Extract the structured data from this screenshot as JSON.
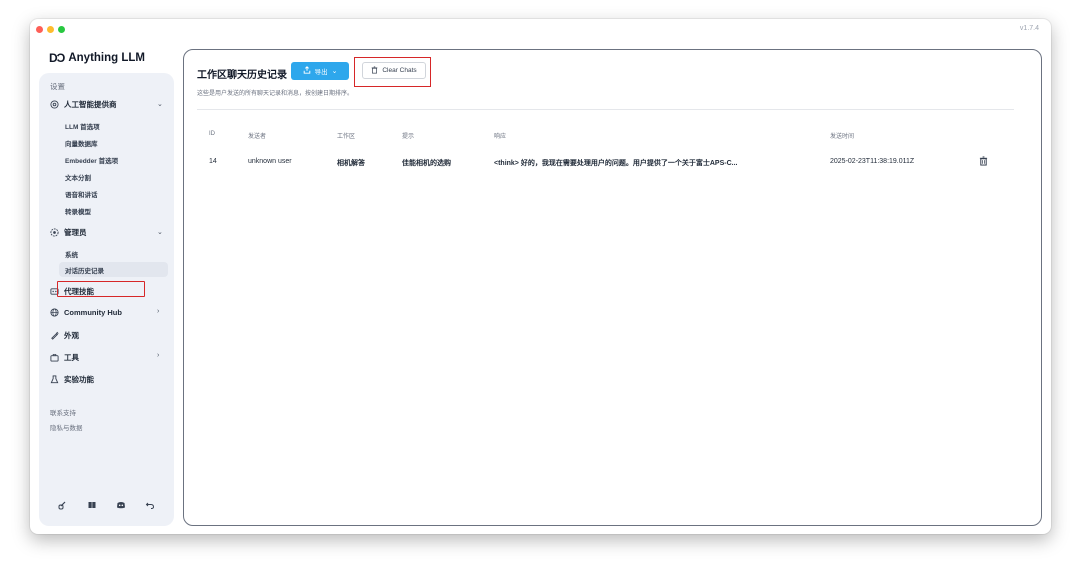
{
  "window": {
    "version": "v1.7.4"
  },
  "sidebar": {
    "brand_logo": "DƆ",
    "brand": "Anything LLM",
    "settings_header": "设置",
    "groups": [
      {
        "label": "人工智能提供商",
        "icon": "gear-circle-icon",
        "expanded": true,
        "items": [
          "LLM 首选项",
          "向量数据库",
          "Embedder 首选项",
          "文本分割",
          "语音和讲话",
          "转录模型"
        ]
      },
      {
        "label": "管理员",
        "icon": "admin-gear-icon",
        "expanded": true,
        "items": [
          "系统",
          "对话历史记录"
        ]
      }
    ],
    "active_item": "对话历史记录",
    "nav": [
      {
        "label": "代理技能",
        "icon": "robot-icon"
      },
      {
        "label": "Community Hub",
        "icon": "globe-icon"
      },
      {
        "label": "外观",
        "icon": "brush-icon"
      },
      {
        "label": "工具",
        "icon": "briefcase-icon"
      },
      {
        "label": "实验功能",
        "icon": "flask-icon"
      }
    ],
    "footer_links": [
      "联系支持",
      "隐私与数据"
    ],
    "bottom_icons": [
      "link-icon",
      "book-icon",
      "discord-icon",
      "back-icon"
    ]
  },
  "main": {
    "title": "工作区聊天历史记录",
    "export_label": "导出",
    "clear_label": "Clear Chats",
    "subtitle": "这些是用户发送的所有聊天记录和消息，按创建日期排序。",
    "columns": [
      "ID",
      "发送者",
      "工作区",
      "提示",
      "响应",
      "发送时间"
    ],
    "rows": [
      {
        "id": "14",
        "sender": "unknown user",
        "workspace": "相机解答",
        "prompt": "佳能相机的选购",
        "response": "<think> 好的，我现在需要处理用户的问题。用户提供了一个关于富士APS-C...",
        "sent_at": "2025-02-23T11:38:19.011Z"
      }
    ]
  },
  "colors": {
    "accent": "#2ea7ec",
    "highlight_box": "#d62728",
    "sidebar_bg": "#eef1f7"
  }
}
